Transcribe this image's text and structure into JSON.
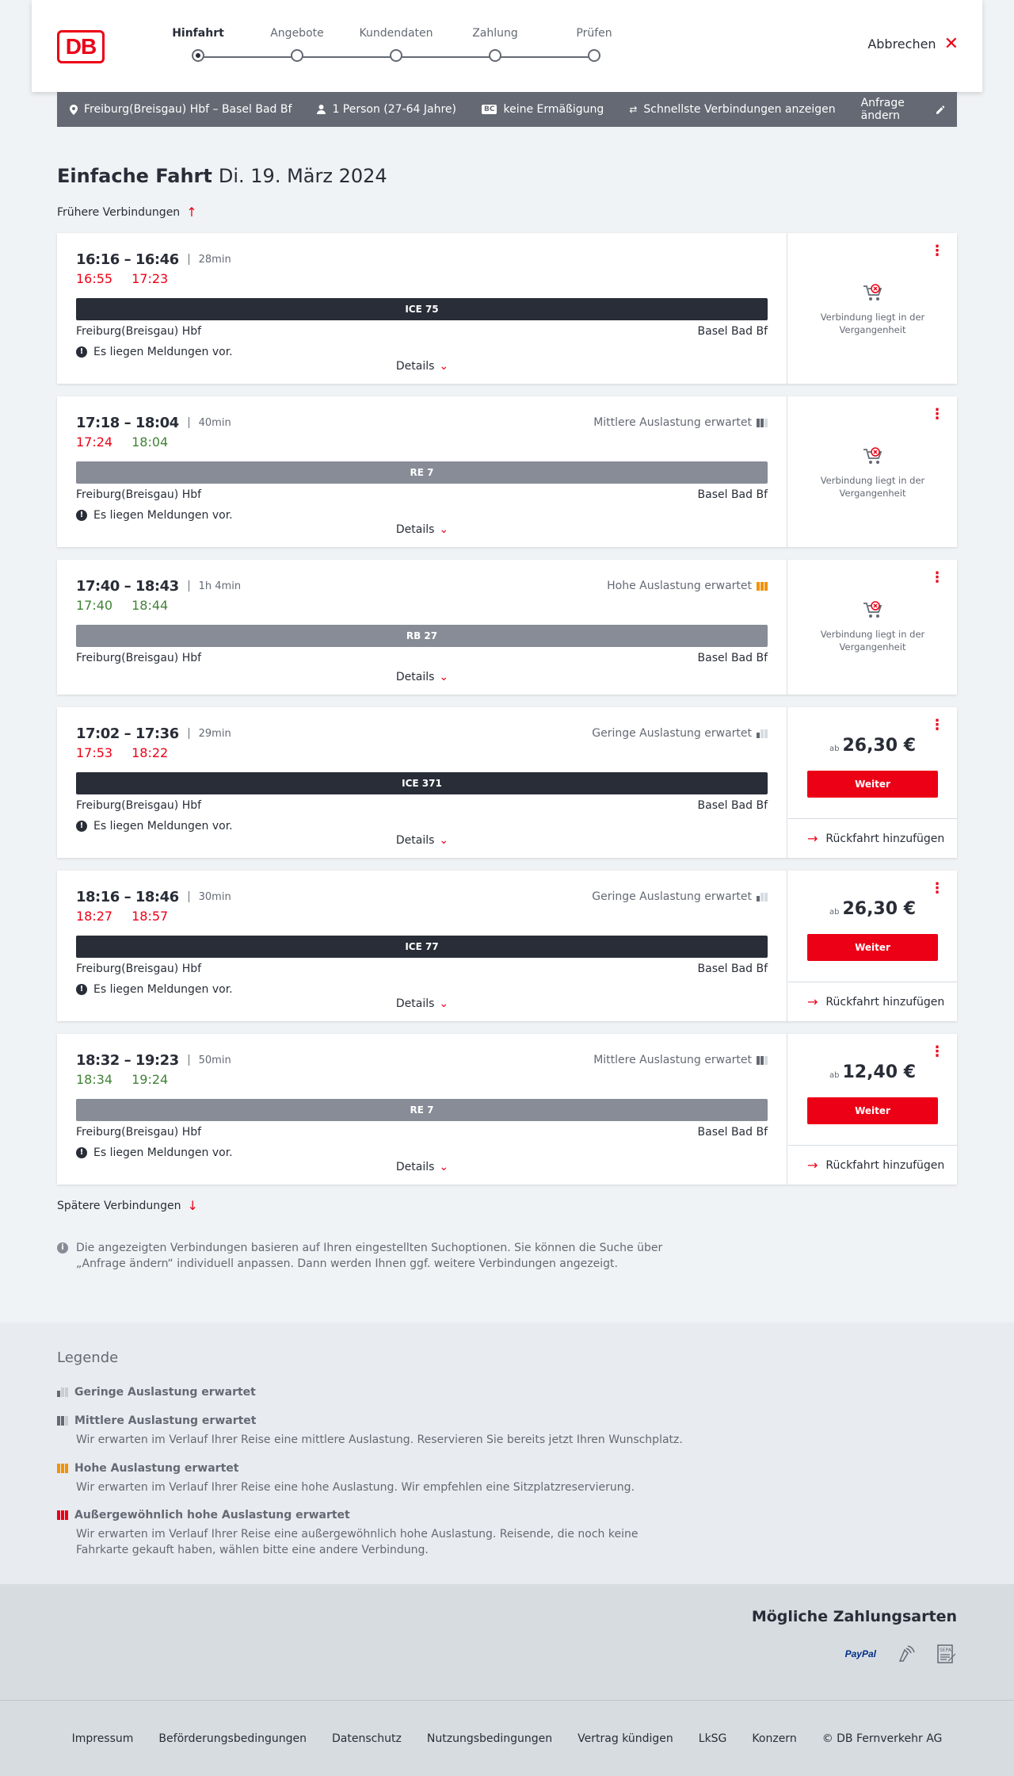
{
  "header": {
    "logo": "DB",
    "steps": [
      {
        "label": "Hinfahrt",
        "active": true
      },
      {
        "label": "Angebote",
        "active": false
      },
      {
        "label": "Kundendaten",
        "active": false
      },
      {
        "label": "Zahlung",
        "active": false
      },
      {
        "label": "Prüfen",
        "active": false
      }
    ],
    "cancel_label": "Abbrechen"
  },
  "search": {
    "route": "Freiburg(Breisgau) Hbf – Basel Bad Bf",
    "persons": "1 Person (27-64 Jahre)",
    "discount_badge": "BC",
    "discount": "keine Ermäßigung",
    "fastest": "Schnellste Verbindungen anzeigen",
    "edit": "Anfrage ändern"
  },
  "page": {
    "title": "Einfache Fahrt",
    "date": "Di. 19. März 2024",
    "earlier": "Frühere Verbindungen",
    "later": "Spätere Verbindungen"
  },
  "labels": {
    "details": "Details",
    "past": "Verbindung liegt in der Vergangenheit",
    "price_prefix": "ab",
    "continue": "Weiter",
    "return_trip": "Rückfahrt hinzufügen",
    "notice": "Es liegen Meldungen vor."
  },
  "connections": [
    {
      "times": "16:16 – 16:46",
      "duration": "28min",
      "rt_dep": "16:55",
      "rt_arr": "17:23",
      "train": "ICE 75",
      "from": "Freiburg(Breisgau) Hbf",
      "to": "Basel Bad Bf",
      "load": ""
    },
    {
      "times": "17:18 – 18:04",
      "duration": "40min",
      "rt_dep": "17:24",
      "rt_arr": "18:04",
      "train": "RE 7",
      "from": "Freiburg(Breisgau) Hbf",
      "to": "Basel Bad Bf",
      "load": "Mittlere Auslastung erwartet"
    },
    {
      "times": "17:40 – 18:43",
      "duration": "1h 4min",
      "rt_dep": "17:40",
      "rt_arr": "18:44",
      "train": "RB 27",
      "from": "Freiburg(Breisgau) Hbf",
      "to": "Basel Bad Bf",
      "load": "Hohe Auslastung erwartet"
    },
    {
      "times": "17:02 – 17:36",
      "duration": "29min",
      "rt_dep": "17:53",
      "rt_arr": "18:22",
      "train": "ICE 371",
      "from": "Freiburg(Breisgau) Hbf",
      "to": "Basel Bad Bf",
      "load": "Geringe Auslastung erwartet",
      "price": "26,30 €"
    },
    {
      "times": "18:16 – 18:46",
      "duration": "30min",
      "rt_dep": "18:27",
      "rt_arr": "18:57",
      "train": "ICE 77",
      "from": "Freiburg(Breisgau) Hbf",
      "to": "Basel Bad Bf",
      "load": "Geringe Auslastung erwartet",
      "price": "26,30 €"
    },
    {
      "times": "18:32 – 19:23",
      "duration": "50min",
      "rt_dep": "18:34",
      "rt_arr": "19:24",
      "train": "RE 7",
      "from": "Freiburg(Breisgau) Hbf",
      "to": "Basel Bad Bf",
      "load": "Mittlere Auslastung erwartet",
      "price": "12,40 €"
    }
  ],
  "info_text": "Die angezeigten Verbindungen basieren auf Ihren eingestellten Suchoptionen. Sie können die Suche über „Anfrage ändern“ individuell anpassen. Dann werden Ihnen ggf. weitere Verbindungen angezeigt.",
  "legend": {
    "title": "Legende",
    "items": [
      {
        "title": "Geringe Auslastung erwartet",
        "desc": ""
      },
      {
        "title": "Mittlere Auslastung erwartet",
        "desc": "Wir erwarten im Verlauf Ihrer Reise eine mittlere Auslastung. Reservieren Sie bereits jetzt Ihren Wunschplatz."
      },
      {
        "title": "Hohe Auslastung erwartet",
        "desc": "Wir erwarten im Verlauf Ihrer Reise eine hohe Auslastung. Wir empfehlen eine Sitzplatzreservierung."
      },
      {
        "title": "Außergewöhnlich hohe Auslastung erwartet",
        "desc": "Wir erwarten im Verlauf Ihrer Reise eine außergewöhnlich hohe Auslastung. Reisende, die noch keine Fahrkarte gekauft haben, wählen bitte eine andere Verbindung."
      }
    ]
  },
  "payment": {
    "title": "Mögliche Zahlungsarten",
    "paypal": "PayPal",
    "sepa": "SEPA"
  },
  "footer": {
    "links": [
      "Impressum",
      "Beförderungsbedingungen",
      "Datenschutz",
      "Nutzungsbedingungen",
      "Vertrag kündigen",
      "LkSG",
      "Konzern",
      "© DB Fernverkehr AG"
    ]
  },
  "colors": {
    "brand_red": "#ec0016",
    "delay_red": "#ec0016",
    "ontime_green": "#408335",
    "high_load": "#f39200",
    "dark_train": "#282d37",
    "grey_train": "#878c96"
  }
}
